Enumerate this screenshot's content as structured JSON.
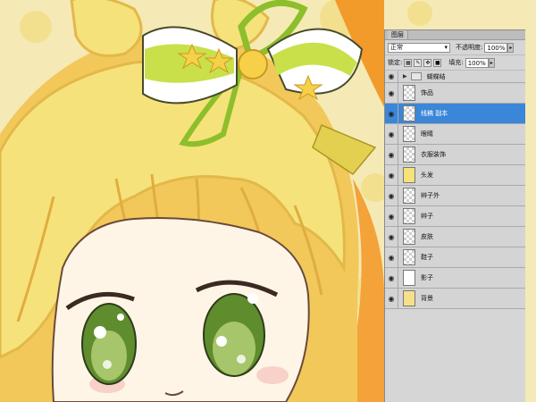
{
  "panel": {
    "tab_label": "图层",
    "blend_mode": "正常",
    "opacity_label": "不透明度:",
    "opacity_value": "100%",
    "lock_label": "锁定:",
    "fill_label": "填充:",
    "fill_value": "100%",
    "group_name": "蝴蝶结",
    "layers": [
      {
        "name": "饰品",
        "selected": false
      },
      {
        "name": "线稿 副本",
        "selected": true
      },
      {
        "name": "眼睛",
        "selected": false
      },
      {
        "name": "衣服装饰",
        "selected": false
      },
      {
        "name": "头发",
        "selected": false
      },
      {
        "name": "辫子外",
        "selected": false
      },
      {
        "name": "辫子",
        "selected": false
      },
      {
        "name": "皮肤",
        "selected": false
      },
      {
        "name": "鞋子",
        "selected": false
      },
      {
        "name": "影子",
        "selected": false
      },
      {
        "name": "背景",
        "selected": false
      }
    ]
  },
  "colors": {
    "hair": "#f6e27a",
    "hair_shadow": "#f2c85a",
    "ribbon_green": "#b7d84a",
    "eye_green": "#5f8d2e",
    "skin": "#fff5e6",
    "selection_blue": "#3a86d8"
  }
}
